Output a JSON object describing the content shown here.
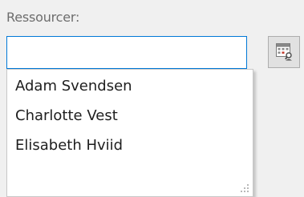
{
  "resources_field": {
    "label": "Ressourcer:",
    "value": "",
    "picker_icon": "resource-picker-icon"
  },
  "dropdown": {
    "items": [
      {
        "label": "Adam Svendsen"
      },
      {
        "label": "Charlotte Vest"
      },
      {
        "label": "Elisabeth Hviid"
      }
    ],
    "grip_icon": "resize-grip-icon"
  },
  "colors": {
    "window_background": "#f0f0f0",
    "input_focus_border": "#0078d7",
    "list_background": "#ffffff",
    "icon_accent_red": "#c0392b"
  }
}
